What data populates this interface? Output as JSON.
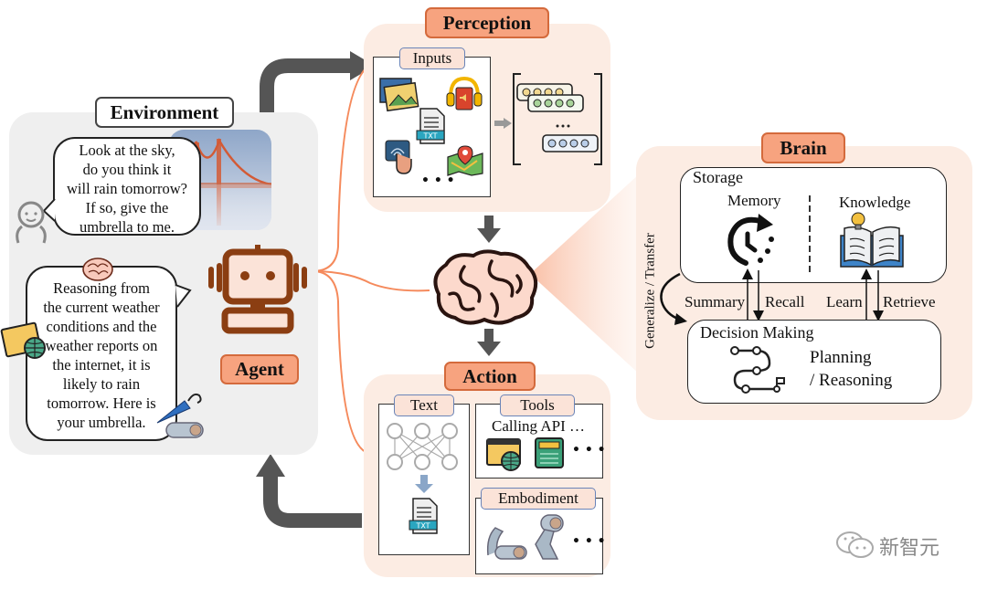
{
  "environment": {
    "title": "Environment",
    "user_message": [
      "Look at the sky,",
      "do you think it",
      "will rain tomorrow?",
      "If so, give the",
      "umbrella to me."
    ],
    "agent_message": [
      "Reasoning from",
      "the current weather",
      "conditions and the",
      "weather reports on",
      "the internet, it is",
      "likely to rain",
      "tomorrow. Here is",
      "your umbrella."
    ],
    "agent_label": "Agent"
  },
  "perception": {
    "title": "Perception",
    "inputs_label": "Inputs",
    "ellipsis": "• • •",
    "vector_ellipsis": "• • •",
    "txt_label": "TXT"
  },
  "brain": {
    "title": "Brain",
    "storage_label": "Storage",
    "memory_label": "Memory",
    "knowledge_label": "Knowledge",
    "generalize_label": "Generalize / Transfer",
    "summary_label": "Summary",
    "recall_label": "Recall",
    "learn_label": "Learn",
    "retrieve_label": "Retrieve",
    "decision_label": "Decision Making",
    "planning_label": "Planning",
    "reasoning_label": "/ Reasoning"
  },
  "action": {
    "title": "Action",
    "text_label": "Text",
    "tools_label": "Tools",
    "calling_api_label": "Calling API …",
    "embodiment_label": "Embodiment",
    "ellipsis": "• • •",
    "txt_label": "TXT"
  },
  "watermark": {
    "text": "新智元"
  },
  "colors": {
    "accent_orange": "#f7a37f",
    "panel_peach": "#fcece3",
    "env_gray": "#efefef",
    "agent_brown": "#8b3e12",
    "arrow_gray": "#555555"
  }
}
